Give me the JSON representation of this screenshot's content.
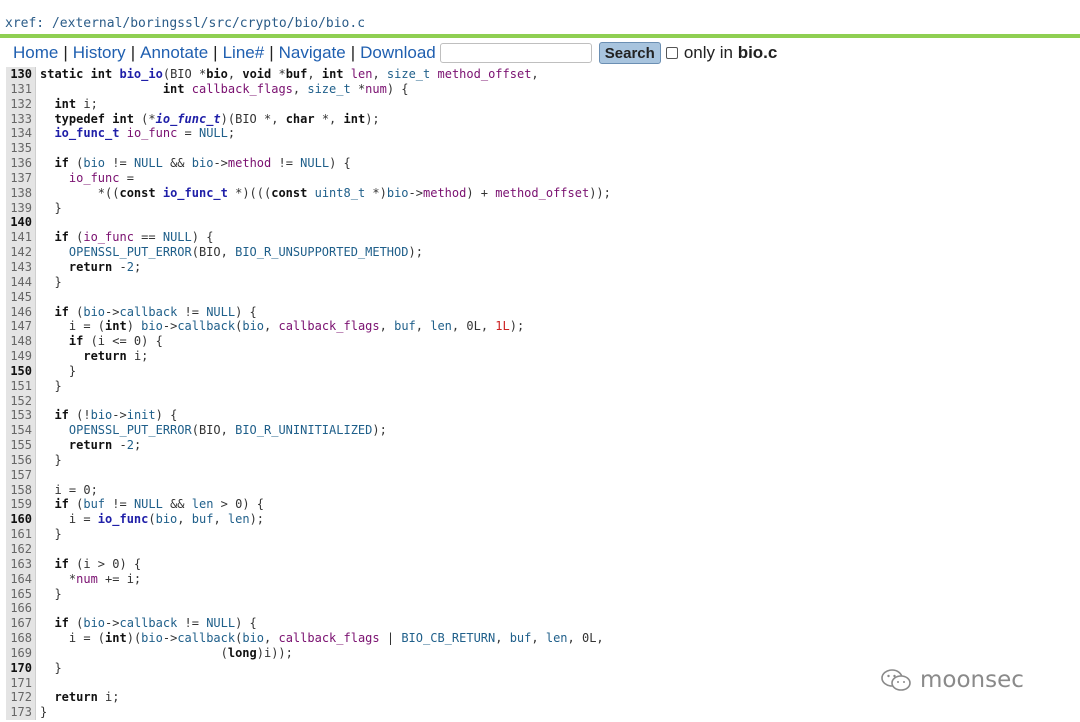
{
  "xref": "xref: /external/boringssl/src/crypto/bio/bio.c",
  "nav": {
    "home": "Home",
    "history": "History",
    "annotate": "Annotate",
    "line": "Line#",
    "navigate": "Navigate",
    "download": "Download",
    "sep": "|",
    "search_placeholder": "",
    "search_button": "Search",
    "only_in": "only in",
    "file": "bio.c"
  },
  "watermark": "moonsec",
  "lines": [
    {
      "n": "130",
      "bold": true
    },
    {
      "n": "131"
    },
    {
      "n": "132"
    },
    {
      "n": "133"
    },
    {
      "n": "134"
    },
    {
      "n": "135"
    },
    {
      "n": "136"
    },
    {
      "n": "137"
    },
    {
      "n": "138"
    },
    {
      "n": "139"
    },
    {
      "n": "140",
      "bold": true
    },
    {
      "n": "141"
    },
    {
      "n": "142"
    },
    {
      "n": "143"
    },
    {
      "n": "144"
    },
    {
      "n": "145"
    },
    {
      "n": "146"
    },
    {
      "n": "147"
    },
    {
      "n": "148"
    },
    {
      "n": "149"
    },
    {
      "n": "150",
      "bold": true
    },
    {
      "n": "151"
    },
    {
      "n": "152"
    },
    {
      "n": "153"
    },
    {
      "n": "154"
    },
    {
      "n": "155"
    },
    {
      "n": "156"
    },
    {
      "n": "157"
    },
    {
      "n": "158"
    },
    {
      "n": "159"
    },
    {
      "n": "160",
      "bold": true
    },
    {
      "n": "161"
    },
    {
      "n": "162"
    },
    {
      "n": "163"
    },
    {
      "n": "164"
    },
    {
      "n": "165"
    },
    {
      "n": "166"
    },
    {
      "n": "167"
    },
    {
      "n": "168"
    },
    {
      "n": "169"
    },
    {
      "n": "170",
      "bold": true
    },
    {
      "n": "171"
    },
    {
      "n": "172"
    },
    {
      "n": "173"
    }
  ],
  "code": [
    [
      [
        "k",
        "static int "
      ],
      [
        "f",
        "bio_io"
      ],
      [
        "c",
        "(BIO *"
      ],
      [
        "k",
        "bio"
      ],
      [
        "c",
        ", "
      ],
      [
        "k",
        "void"
      ],
      [
        "c",
        " *"
      ],
      [
        "k",
        "buf"
      ],
      [
        "c",
        ", "
      ],
      [
        "k",
        "int"
      ],
      [
        "c",
        " "
      ],
      [
        "d",
        "len"
      ],
      [
        "c",
        ", "
      ],
      [
        "m",
        "size_t"
      ],
      [
        "c",
        " "
      ],
      [
        "d",
        "method_offset"
      ],
      [
        "c",
        ","
      ]
    ],
    [
      [
        "c",
        "                 "
      ],
      [
        "k",
        "int"
      ],
      [
        "c",
        " "
      ],
      [
        "d",
        "callback_flags"
      ],
      [
        "c",
        ", "
      ],
      [
        "m",
        "size_t"
      ],
      [
        "c",
        " *"
      ],
      [
        "d",
        "num"
      ],
      [
        "c",
        ") {"
      ]
    ],
    [
      [
        "c",
        "  "
      ],
      [
        "k",
        "int"
      ],
      [
        "c",
        " i;"
      ]
    ],
    [
      [
        "c",
        "  "
      ],
      [
        "k",
        "typedef int"
      ],
      [
        "c",
        " (*"
      ],
      [
        "fi",
        "io_func_t"
      ],
      [
        "c",
        ")(BIO *, "
      ],
      [
        "k",
        "char"
      ],
      [
        "c",
        " *, "
      ],
      [
        "k",
        "int"
      ],
      [
        "c",
        ");"
      ]
    ],
    [
      [
        "c",
        "  "
      ],
      [
        "f",
        "io_func_t"
      ],
      [
        "c",
        " "
      ],
      [
        "d",
        "io_func"
      ],
      [
        "c",
        " = "
      ],
      [
        "m",
        "NULL"
      ],
      [
        "c",
        ";"
      ]
    ],
    [
      [
        "c",
        ""
      ]
    ],
    [
      [
        "c",
        "  "
      ],
      [
        "k",
        "if"
      ],
      [
        "c",
        " ("
      ],
      [
        "m",
        "bio"
      ],
      [
        "c",
        " != "
      ],
      [
        "m",
        "NULL"
      ],
      [
        "c",
        " && "
      ],
      [
        "m",
        "bio"
      ],
      [
        "c",
        "->"
      ],
      [
        "d",
        "method"
      ],
      [
        "c",
        " != "
      ],
      [
        "m",
        "NULL"
      ],
      [
        "c",
        ") {"
      ]
    ],
    [
      [
        "c",
        "    "
      ],
      [
        "d",
        "io_func"
      ],
      [
        "c",
        " ="
      ]
    ],
    [
      [
        "c",
        "        *(("
      ],
      [
        "k",
        "const"
      ],
      [
        "c",
        " "
      ],
      [
        "f",
        "io_func_t"
      ],
      [
        "c",
        " *)((("
      ],
      [
        "k",
        "const"
      ],
      [
        "c",
        " "
      ],
      [
        "m",
        "uint8_t"
      ],
      [
        "c",
        " *)"
      ],
      [
        "m",
        "bio"
      ],
      [
        "c",
        "->"
      ],
      [
        "d",
        "method"
      ],
      [
        "c",
        ") + "
      ],
      [
        "d",
        "method_offset"
      ],
      [
        "c",
        "));"
      ]
    ],
    [
      [
        "c",
        "  }"
      ]
    ],
    [
      [
        "c",
        ""
      ]
    ],
    [
      [
        "c",
        "  "
      ],
      [
        "k",
        "if"
      ],
      [
        "c",
        " ("
      ],
      [
        "d",
        "io_func"
      ],
      [
        "c",
        " == "
      ],
      [
        "m",
        "NULL"
      ],
      [
        "c",
        ") {"
      ]
    ],
    [
      [
        "c",
        "    "
      ],
      [
        "m",
        "OPENSSL_PUT_ERROR"
      ],
      [
        "c",
        "(BIO, "
      ],
      [
        "m",
        "BIO_R_UNSUPPORTED_METHOD"
      ],
      [
        "c",
        ");"
      ]
    ],
    [
      [
        "c",
        "    "
      ],
      [
        "k",
        "return"
      ],
      [
        "c",
        " -"
      ],
      [
        "m",
        "2"
      ],
      [
        "c",
        ";"
      ]
    ],
    [
      [
        "c",
        "  }"
      ]
    ],
    [
      [
        "c",
        ""
      ]
    ],
    [
      [
        "c",
        "  "
      ],
      [
        "k",
        "if"
      ],
      [
        "c",
        " ("
      ],
      [
        "m",
        "bio"
      ],
      [
        "c",
        "->"
      ],
      [
        "m",
        "callback"
      ],
      [
        "c",
        " != "
      ],
      [
        "m",
        "NULL"
      ],
      [
        "c",
        ") {"
      ]
    ],
    [
      [
        "c",
        "    i = ("
      ],
      [
        "k",
        "int"
      ],
      [
        "c",
        ") "
      ],
      [
        "m",
        "bio"
      ],
      [
        "c",
        "->"
      ],
      [
        "m",
        "callback"
      ],
      [
        "c",
        "("
      ],
      [
        "m",
        "bio"
      ],
      [
        "c",
        ", "
      ],
      [
        "d",
        "callback_flags"
      ],
      [
        "c",
        ", "
      ],
      [
        "m",
        "buf"
      ],
      [
        "c",
        ", "
      ],
      [
        "m",
        "len"
      ],
      [
        "c",
        ", 0L, "
      ],
      [
        "n",
        "1L"
      ],
      [
        "c",
        ");"
      ]
    ],
    [
      [
        "c",
        "    "
      ],
      [
        "k",
        "if"
      ],
      [
        "c",
        " (i <= 0) {"
      ]
    ],
    [
      [
        "c",
        "      "
      ],
      [
        "k",
        "return"
      ],
      [
        "c",
        " i;"
      ]
    ],
    [
      [
        "c",
        "    }"
      ]
    ],
    [
      [
        "c",
        "  }"
      ]
    ],
    [
      [
        "c",
        ""
      ]
    ],
    [
      [
        "c",
        "  "
      ],
      [
        "k",
        "if"
      ],
      [
        "c",
        " (!"
      ],
      [
        "m",
        "bio"
      ],
      [
        "c",
        "->"
      ],
      [
        "m",
        "init"
      ],
      [
        "c",
        ") {"
      ]
    ],
    [
      [
        "c",
        "    "
      ],
      [
        "m",
        "OPENSSL_PUT_ERROR"
      ],
      [
        "c",
        "(BIO, "
      ],
      [
        "m",
        "BIO_R_UNINITIALIZED"
      ],
      [
        "c",
        ");"
      ]
    ],
    [
      [
        "c",
        "    "
      ],
      [
        "k",
        "return"
      ],
      [
        "c",
        " -"
      ],
      [
        "m",
        "2"
      ],
      [
        "c",
        ";"
      ]
    ],
    [
      [
        "c",
        "  }"
      ]
    ],
    [
      [
        "c",
        ""
      ]
    ],
    [
      [
        "c",
        "  i = 0;"
      ]
    ],
    [
      [
        "c",
        "  "
      ],
      [
        "k",
        "if"
      ],
      [
        "c",
        " ("
      ],
      [
        "m",
        "buf"
      ],
      [
        "c",
        " != "
      ],
      [
        "m",
        "NULL"
      ],
      [
        "c",
        " && "
      ],
      [
        "m",
        "len"
      ],
      [
        "c",
        " > 0) {"
      ]
    ],
    [
      [
        "c",
        "    i = "
      ],
      [
        "f",
        "io_func"
      ],
      [
        "c",
        "("
      ],
      [
        "m",
        "bio"
      ],
      [
        "c",
        ", "
      ],
      [
        "m",
        "buf"
      ],
      [
        "c",
        ", "
      ],
      [
        "m",
        "len"
      ],
      [
        "c",
        ");"
      ]
    ],
    [
      [
        "c",
        "  }"
      ]
    ],
    [
      [
        "c",
        ""
      ]
    ],
    [
      [
        "c",
        "  "
      ],
      [
        "k",
        "if"
      ],
      [
        "c",
        " (i > 0) {"
      ]
    ],
    [
      [
        "c",
        "    *"
      ],
      [
        "d",
        "num"
      ],
      [
        "c",
        " += i;"
      ]
    ],
    [
      [
        "c",
        "  }"
      ]
    ],
    [
      [
        "c",
        ""
      ]
    ],
    [
      [
        "c",
        "  "
      ],
      [
        "k",
        "if"
      ],
      [
        "c",
        " ("
      ],
      [
        "m",
        "bio"
      ],
      [
        "c",
        "->"
      ],
      [
        "m",
        "callback"
      ],
      [
        "c",
        " != "
      ],
      [
        "m",
        "NULL"
      ],
      [
        "c",
        ") {"
      ]
    ],
    [
      [
        "c",
        "    i = ("
      ],
      [
        "k",
        "int"
      ],
      [
        "c",
        ")("
      ],
      [
        "m",
        "bio"
      ],
      [
        "c",
        "->"
      ],
      [
        "m",
        "callback"
      ],
      [
        "c",
        "("
      ],
      [
        "m",
        "bio"
      ],
      [
        "c",
        ", "
      ],
      [
        "d",
        "callback_flags"
      ],
      [
        "c",
        " | "
      ],
      [
        "m",
        "BIO_CB_RETURN"
      ],
      [
        "c",
        ", "
      ],
      [
        "m",
        "buf"
      ],
      [
        "c",
        ", "
      ],
      [
        "m",
        "len"
      ],
      [
        "c",
        ", 0L,"
      ]
    ],
    [
      [
        "c",
        "                         ("
      ],
      [
        "k",
        "long"
      ],
      [
        "c",
        ")i));"
      ]
    ],
    [
      [
        "c",
        "  }"
      ]
    ],
    [
      [
        "c",
        ""
      ]
    ],
    [
      [
        "c",
        "  "
      ],
      [
        "k",
        "return"
      ],
      [
        "c",
        " i;"
      ]
    ],
    [
      [
        "c",
        "}"
      ]
    ]
  ]
}
